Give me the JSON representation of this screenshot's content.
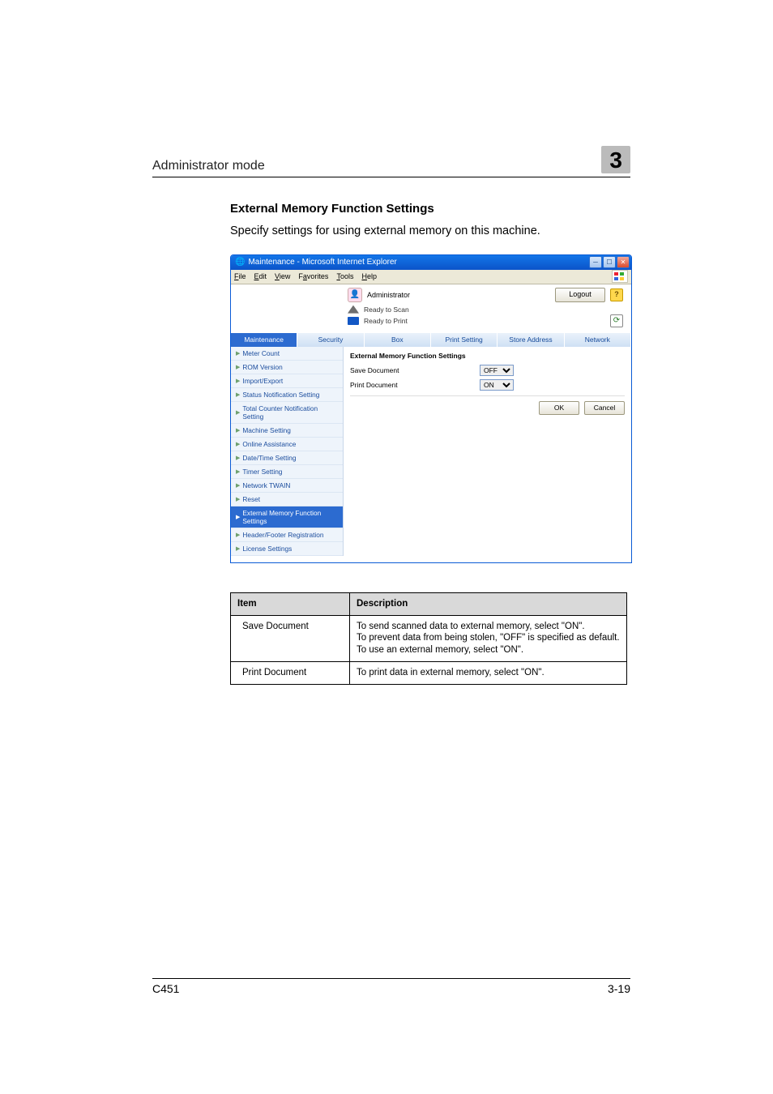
{
  "header": {
    "title": "Administrator mode",
    "chapter": "3"
  },
  "section": {
    "heading": "External Memory Function Settings",
    "intro": "Specify settings for using external memory on this machine."
  },
  "ie": {
    "title": "Maintenance - Microsoft Internet Explorer",
    "menus": [
      "File",
      "Edit",
      "View",
      "Favorites",
      "Tools",
      "Help"
    ],
    "admin_label": "Administrator",
    "logout": "Logout",
    "status": {
      "scan": "Ready to Scan",
      "print": "Ready to Print"
    },
    "tabs": [
      "Maintenance",
      "Security",
      "Box",
      "Print Setting",
      "Store Address",
      "Network"
    ],
    "active_tab": 0,
    "sidebar": [
      "Meter Count",
      "ROM Version",
      "Import/Export",
      "Status Notification Setting",
      "Total Counter Notification Setting",
      "Machine Setting",
      "Online Assistance",
      "Date/Time Setting",
      "Timer Setting",
      "Network TWAIN",
      "Reset",
      "External Memory Function Settings",
      "Header/Footer Registration",
      "License Settings"
    ],
    "active_sidebar": 11,
    "panel": {
      "title": "External Memory Function Settings",
      "rows": [
        {
          "label": "Save Document",
          "value": "OFF",
          "options": [
            "OFF",
            "ON"
          ]
        },
        {
          "label": "Print Document",
          "value": "ON",
          "options": [
            "OFF",
            "ON"
          ]
        }
      ],
      "ok": "OK",
      "cancel": "Cancel"
    }
  },
  "table": {
    "headers": [
      "Item",
      "Description"
    ],
    "rows": [
      {
        "item": "Save Document",
        "desc": "To send scanned data to external memory, select \"ON\".\nTo prevent data from being stolen, \"OFF\" is specified as default. To use an external memory, select \"ON\"."
      },
      {
        "item": "Print Document",
        "desc": "To print data in external memory, select \"ON\"."
      }
    ]
  },
  "footer": {
    "left": "C451",
    "right": "3-19"
  }
}
